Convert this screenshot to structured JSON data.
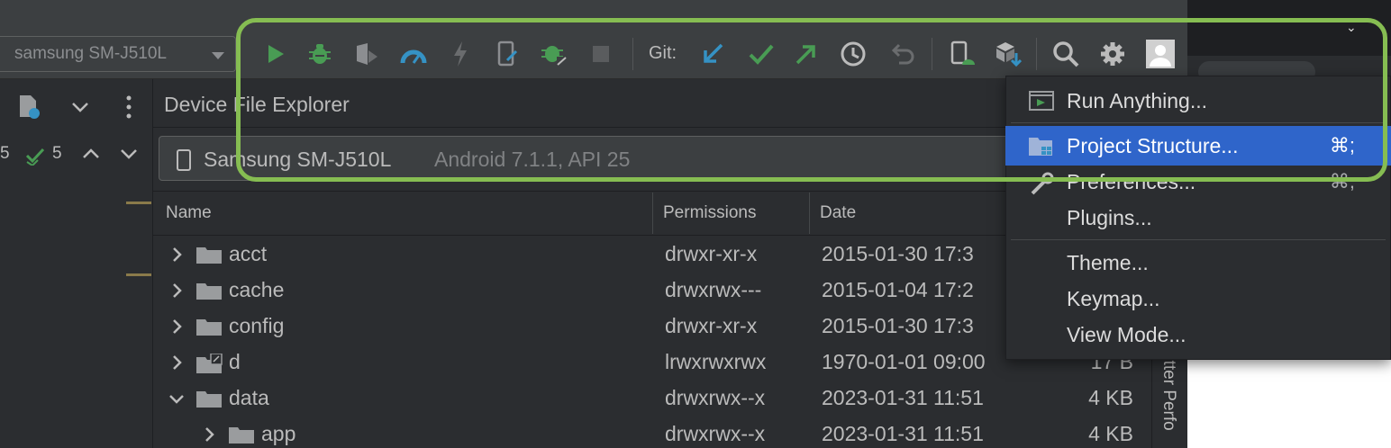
{
  "toolbar": {
    "device_selector": "samsung SM-J510L",
    "git_label": "Git:",
    "icons": [
      "run-icon",
      "debug-icon",
      "profile-icon",
      "profiler-icon",
      "apply-changes-icon",
      "apply-code-changes-icon",
      "attach-debugger-icon",
      "stop-icon",
      "git-update-icon",
      "git-commit-icon",
      "git-push-icon",
      "git-history-icon",
      "git-rollback-icon",
      "device-manager-icon",
      "sdk-manager-icon",
      "search-icon",
      "settings-icon",
      "user-avatar-icon"
    ],
    "colors": {
      "run": "#499c54",
      "debug": "#499c54",
      "profiler": "#3592c4",
      "git_update": "#3592c4",
      "git_commit": "#499c54",
      "git_push": "#499c54"
    }
  },
  "left_gutter": {
    "count_left": "5",
    "count_checks": "5"
  },
  "panel": {
    "title": "Device File Explorer",
    "device_name": "Samsung SM-J510L",
    "device_version": "Android 7.1.1, API 25"
  },
  "table": {
    "columns": [
      "Name",
      "Permissions",
      "Date"
    ],
    "rows": [
      {
        "name": "acct",
        "permissions": "drwxr-xr-x",
        "date": "2015-01-30 17:3",
        "size": "",
        "expanded": false,
        "indent": 0,
        "link": false
      },
      {
        "name": "cache",
        "permissions": "drwxrwx---",
        "date": "2015-01-04 17:2",
        "size": "",
        "expanded": false,
        "indent": 0,
        "link": false
      },
      {
        "name": "config",
        "permissions": "drwxr-xr-x",
        "date": "2015-01-30 17:3",
        "size": "",
        "expanded": false,
        "indent": 0,
        "link": false
      },
      {
        "name": "d",
        "permissions": "lrwxrwxrwx",
        "date": "1970-01-01 09:00",
        "size": "17 B",
        "expanded": false,
        "indent": 0,
        "link": true
      },
      {
        "name": "data",
        "permissions": "drwxrwx--x",
        "date": "2023-01-31 11:51",
        "size": "4 KB",
        "expanded": true,
        "indent": 0,
        "link": false
      },
      {
        "name": "app",
        "permissions": "drwxrwx--x",
        "date": "2023-01-31 11:51",
        "size": "4 KB",
        "expanded": false,
        "indent": 1,
        "link": false
      }
    ]
  },
  "side_strip": {
    "label": "utter Perfo"
  },
  "menu": {
    "items": [
      {
        "label": "Run Anything...",
        "shortcut": "",
        "selected": false
      },
      {
        "label": "Project Structure...",
        "shortcut": "⌘;",
        "selected": true
      },
      {
        "label": "Preferences...",
        "shortcut": "⌘,",
        "selected": false
      },
      {
        "label": "Plugins...",
        "shortcut": "",
        "selected": false
      },
      {
        "label": "Theme...",
        "shortcut": "",
        "selected": false
      },
      {
        "label": "Keymap...",
        "shortcut": "",
        "selected": false
      },
      {
        "label": "View Mode...",
        "shortcut": "",
        "selected": false
      }
    ],
    "selected_color": "#2f65ca"
  },
  "highlight_color": "#86bd52"
}
